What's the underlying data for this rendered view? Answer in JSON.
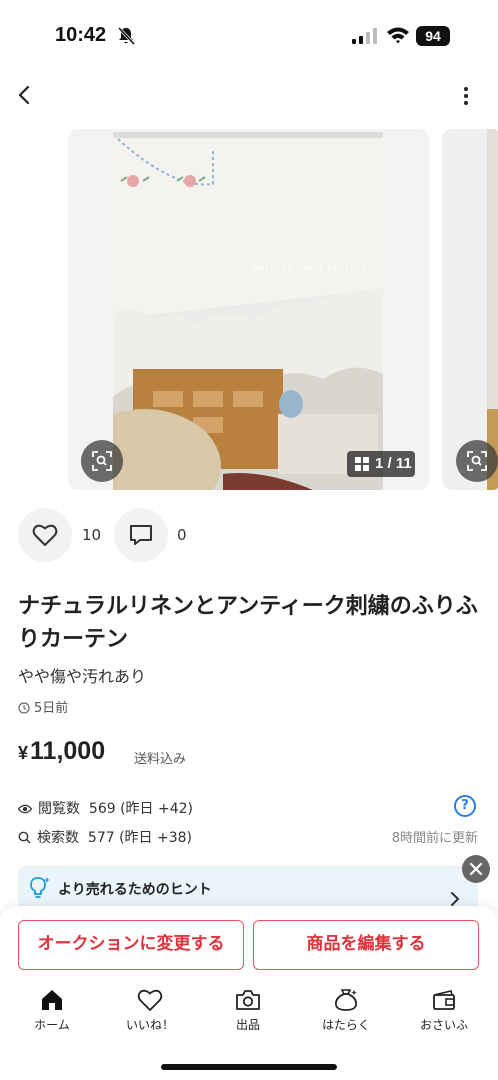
{
  "status_bar": {
    "time": "10:42",
    "battery": "94"
  },
  "gallery": {
    "counter": "1 / 11",
    "photo_caption": "natural linen curtain"
  },
  "reactions": {
    "likes": "10",
    "comments": "0"
  },
  "item": {
    "title": "ナチュラルリネンとアンティーク刺繍のふりふりカーテン",
    "condition": "やや傷や汚れあり",
    "posted": "5日前",
    "price_symbol": "¥",
    "price": "11,000",
    "shipping": "送料込み"
  },
  "stats": {
    "views_label": "閲覧数",
    "views_value": "569 (昨日 +42)",
    "searches_label": "検索数",
    "searches_value": "577 (昨日 +38)",
    "help": "?",
    "updated": "8時間前に更新"
  },
  "hint": {
    "text": "より売れるためのヒント"
  },
  "actions": {
    "auction": "オークションに変更する",
    "edit": "商品を編集する"
  },
  "tabs": [
    {
      "label": "ホーム",
      "icon": "home-icon"
    },
    {
      "label": "いいね！",
      "icon": "heart-icon"
    },
    {
      "label": "出品",
      "icon": "camera-icon"
    },
    {
      "label": "はたらく",
      "icon": "money-bag-icon"
    },
    {
      "label": "おさいふ",
      "icon": "wallet-icon"
    }
  ],
  "colors": {
    "accent_red": "#e0333b",
    "help_blue": "#2a7de1",
    "hint_bg": "#eaf4fb"
  }
}
